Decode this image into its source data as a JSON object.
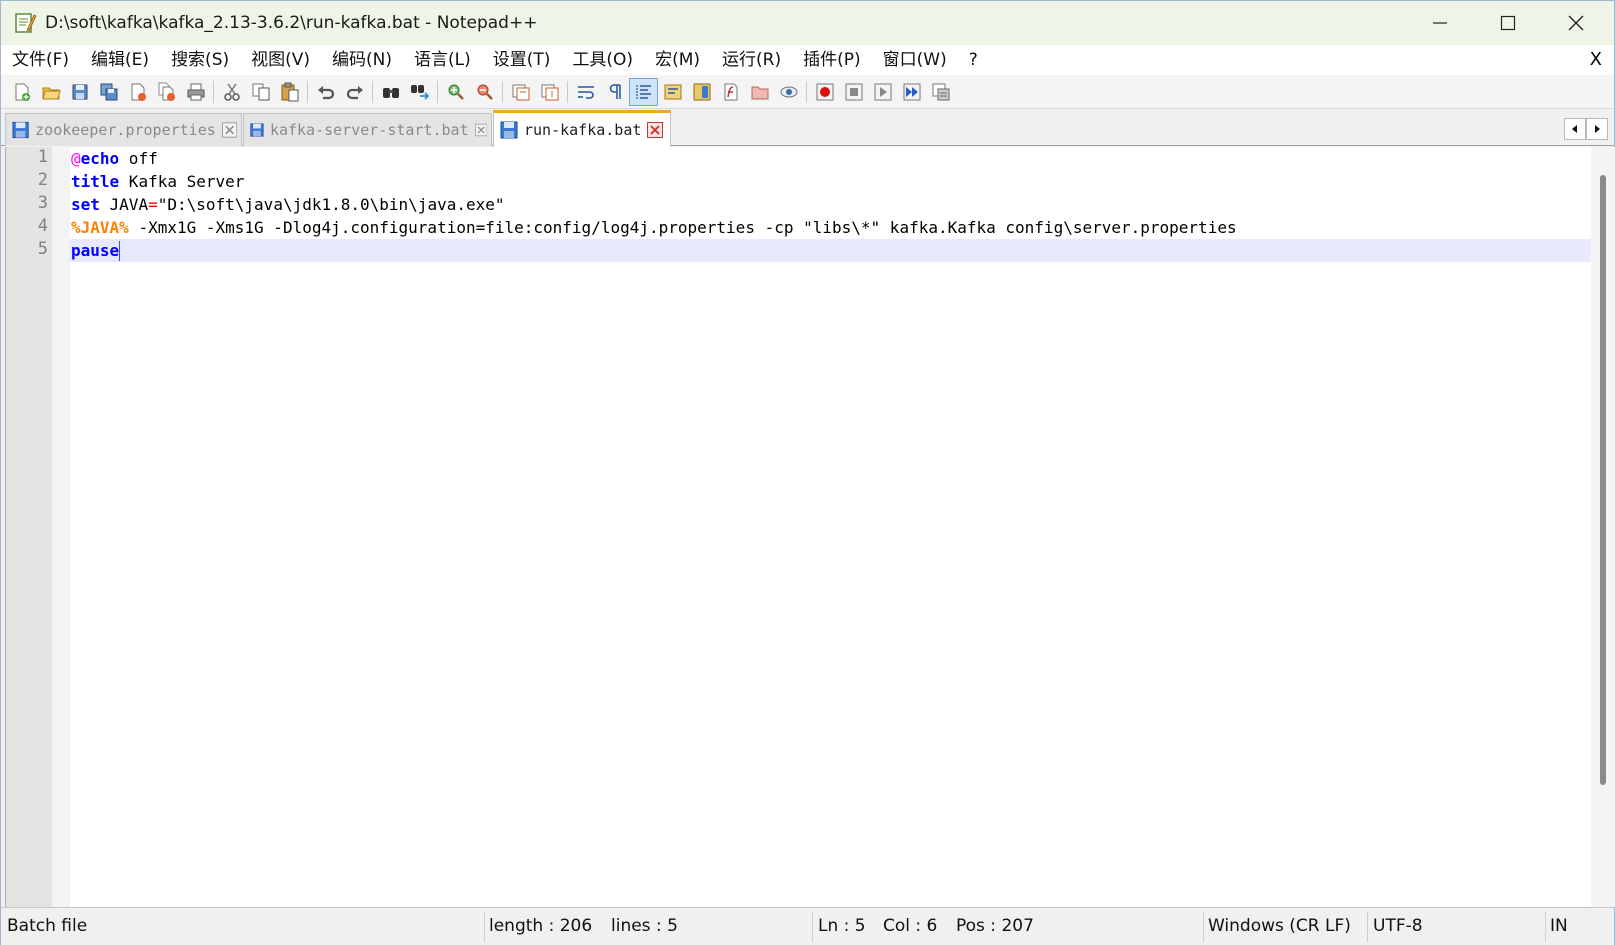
{
  "window": {
    "title": "D:\\soft\\kafka\\kafka_2.13-3.6.2\\run-kafka.bat - Notepad++"
  },
  "menu": {
    "items": [
      "文件(F)",
      "编辑(E)",
      "搜索(S)",
      "视图(V)",
      "编码(N)",
      "语言(L)",
      "设置(T)",
      "工具(O)",
      "宏(M)",
      "运行(R)",
      "插件(P)",
      "窗口(W)",
      "?"
    ],
    "close_doc": "X"
  },
  "toolbar": {
    "icons": [
      "new-file-icon",
      "open-file-icon",
      "save-icon",
      "save-all-icon",
      "close-icon",
      "close-all-icon",
      "print-icon",
      "cut-icon",
      "copy-icon",
      "paste-icon",
      "undo-icon",
      "redo-icon",
      "find-icon",
      "replace-icon",
      "zoom-in-icon",
      "zoom-out-icon",
      "sync-vertical-icon",
      "sync-horizontal-icon",
      "word-wrap-icon",
      "show-all-chars-icon",
      "indent-guide-icon",
      "udl-icon",
      "doc-map-icon",
      "function-list-icon",
      "folder-as-workspace-icon",
      "monitoring-icon",
      "macro-record-icon",
      "macro-stop-icon",
      "macro-play-icon",
      "macro-run-multiple-icon",
      "macro-save-icon"
    ]
  },
  "tabs": [
    {
      "label": "zookeeper.properties",
      "active": false
    },
    {
      "label": "kafka-server-start.bat",
      "active": false
    },
    {
      "label": "run-kafka.bat",
      "active": true
    }
  ],
  "editor": {
    "line_numbers": [
      "1",
      "2",
      "3",
      "4",
      "5"
    ],
    "lines": [
      [
        {
          "t": "@",
          "c": "at"
        },
        {
          "t": "echo",
          "c": "kw"
        },
        {
          "t": " off",
          "c": "txt"
        }
      ],
      [
        {
          "t": "title",
          "c": "kw"
        },
        {
          "t": " Kafka Server",
          "c": "txt"
        }
      ],
      [
        {
          "t": "set",
          "c": "kw"
        },
        {
          "t": " JAVA",
          "c": "txt"
        },
        {
          "t": "=",
          "c": "op"
        },
        {
          "t": "\"D:\\soft\\java\\jdk1.8.0\\bin\\java.exe\"",
          "c": "txt"
        }
      ],
      [
        {
          "t": "%",
          "c": "var"
        },
        {
          "t": "JAVA",
          "c": "var"
        },
        {
          "t": "%",
          "c": "var"
        },
        {
          "t": " -Xmx1G -Xms1G -Dlog4j.configuration=file:config/log4j.properties -cp \"libs\\*\" kafka.Kafka config\\server.properties",
          "c": "txt"
        }
      ],
      [
        {
          "t": "pause",
          "c": "kw"
        }
      ]
    ],
    "current_line": 5
  },
  "status": {
    "file_type": "Batch file",
    "length": "length : 206",
    "lines": "lines : 5",
    "ln": "Ln : 5",
    "col": "Col : 6",
    "pos": "Pos : 207",
    "eol": "Windows (CR LF)",
    "encoding": "UTF-8",
    "mode": "IN"
  },
  "colors": {
    "keyword": "#0000ff",
    "variable": "#ff8000",
    "at_symbol": "#ff00ff",
    "operator": "#ff0000",
    "current_line_bg": "#e8e8ff",
    "active_tab_accent": "#f5a623"
  }
}
